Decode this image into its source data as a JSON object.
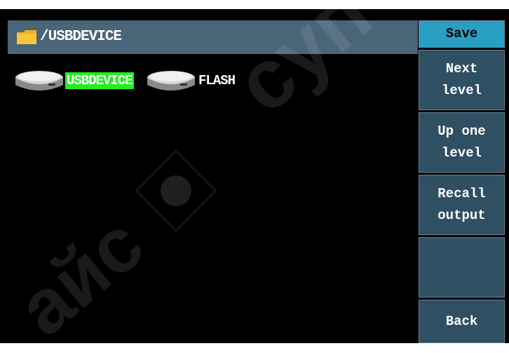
{
  "path": "/USBDEVICE",
  "drives": [
    {
      "label": "USBDEVICE",
      "icon": "drive-icon",
      "selected": true
    },
    {
      "label": "FLASH",
      "icon": "drive-icon",
      "selected": false
    }
  ],
  "menu": {
    "save": "Save",
    "next_level_1": "Next",
    "next_level_2": "level",
    "up_one_1": "Up one",
    "up_one_2": "level",
    "recall_1": "Recall",
    "recall_2": "output",
    "empty": "",
    "back": "Back"
  },
  "colors": {
    "menu_active": "#2a9fc4",
    "menu_bg": "#2f4f63",
    "path_bar": "#4a6478",
    "selection": "#22ee22"
  },
  "watermark": {
    "text_top": "суп",
    "text_bottom": "айс"
  }
}
